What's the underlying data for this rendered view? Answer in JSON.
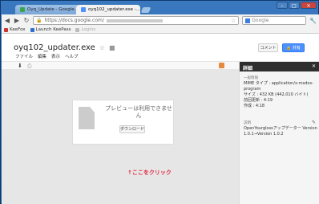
{
  "browser": {
    "tabs": [
      {
        "label": "Oyq_Update - Google...",
        "active": false
      },
      {
        "label": "oyq102_updater.exe -...",
        "active": true
      }
    ],
    "url": "https://docs.google.com/",
    "search_placeholder": "Google",
    "bookmarks": [
      "KeeFox",
      "Launch KeePass",
      "Logins"
    ]
  },
  "doc": {
    "title": "oyq102_updater.exe",
    "menu": [
      "ファイル",
      "編集",
      "表示",
      "ヘルプ"
    ],
    "comment_label": "コメント",
    "share_label": "共有"
  },
  "preview": {
    "message": "プレビューは利用できません",
    "download_label": "ダウンロード",
    "annotation": "↑ここをクリック"
  },
  "details": {
    "header": "詳細",
    "general_label": "一般情報",
    "mime": "MIME タイプ : application/x-msdos-program",
    "size": "サイズ : 432 KB (442,010 バイト)",
    "last_modified": "前回更新 : 4:19",
    "created": "作成 : 4:18",
    "description_label": "説明",
    "description": "OpenYourglossアップデーター Version 1.0.1→Version 1.0.2"
  },
  "colors": {
    "share_blue": "#4d90fe",
    "annotation_red": "#e0334a",
    "frame_blue": "#3a78bf"
  }
}
